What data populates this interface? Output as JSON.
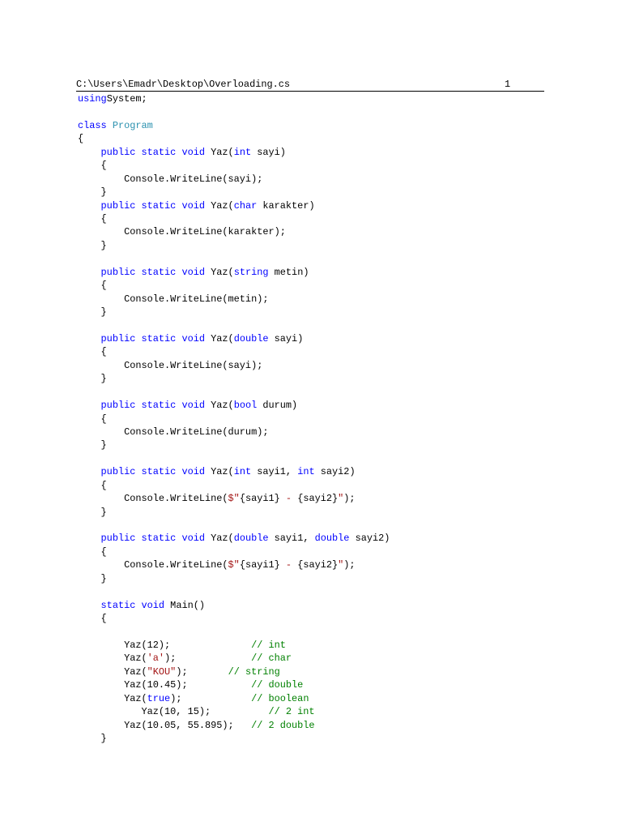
{
  "header": {
    "file_path": "C:\\Users\\Emadr\\Desktop\\Overloading.cs",
    "page_number": "1"
  },
  "colors": {
    "keyword": "#0000ff",
    "type": "#2b91af",
    "string": "#a31515",
    "comment": "#008000"
  },
  "code_lines": [
    [
      [
        "k",
        "using"
      ],
      [
        "",
        "System;"
      ]
    ],
    [],
    [
      [
        "k",
        "class"
      ],
      [
        "",
        " "
      ],
      [
        "y",
        "Program"
      ]
    ],
    [
      [
        "",
        "{"
      ]
    ],
    [
      [
        "",
        "    "
      ],
      [
        "k",
        "public static void"
      ],
      [
        "",
        " Yaz("
      ],
      [
        "k",
        "int"
      ],
      [
        "",
        " sayi)"
      ]
    ],
    [
      [
        "",
        "    {"
      ]
    ],
    [
      [
        "",
        "        Console.WriteLine(sayi);"
      ]
    ],
    [
      [
        "",
        "    }"
      ]
    ],
    [
      [
        "",
        "    "
      ],
      [
        "k",
        "public static void"
      ],
      [
        "",
        " Yaz("
      ],
      [
        "k",
        "char"
      ],
      [
        "",
        " karakter)"
      ]
    ],
    [
      [
        "",
        "    {"
      ]
    ],
    [
      [
        "",
        "        Console.WriteLine(karakter);"
      ]
    ],
    [
      [
        "",
        "    }"
      ]
    ],
    [],
    [
      [
        "",
        "    "
      ],
      [
        "k",
        "public static void"
      ],
      [
        "",
        " Yaz("
      ],
      [
        "k",
        "string"
      ],
      [
        "",
        " metin)"
      ]
    ],
    [
      [
        "",
        "    {"
      ]
    ],
    [
      [
        "",
        "        Console.WriteLine(metin);"
      ]
    ],
    [
      [
        "",
        "    }"
      ]
    ],
    [],
    [
      [
        "",
        "    "
      ],
      [
        "k",
        "public static void"
      ],
      [
        "",
        " Yaz("
      ],
      [
        "k",
        "double"
      ],
      [
        "",
        " sayi)"
      ]
    ],
    [
      [
        "",
        "    {"
      ]
    ],
    [
      [
        "",
        "        Console.WriteLine(sayi);"
      ]
    ],
    [
      [
        "",
        "    }"
      ]
    ],
    [],
    [
      [
        "",
        "    "
      ],
      [
        "k",
        "public static void"
      ],
      [
        "",
        " Yaz("
      ],
      [
        "k",
        "bool"
      ],
      [
        "",
        " durum)"
      ]
    ],
    [
      [
        "",
        "    {"
      ]
    ],
    [
      [
        "",
        "        Console.WriteLine(durum);"
      ]
    ],
    [
      [
        "",
        "    }"
      ]
    ],
    [],
    [
      [
        "",
        "    "
      ],
      [
        "k",
        "public static void"
      ],
      [
        "",
        " Yaz("
      ],
      [
        "k",
        "int"
      ],
      [
        "",
        " sayi1, "
      ],
      [
        "k",
        "int"
      ],
      [
        "",
        " sayi2)"
      ]
    ],
    [
      [
        "",
        "    {"
      ]
    ],
    [
      [
        "",
        "        Console.WriteLine("
      ],
      [
        "s",
        "$\""
      ],
      [
        "",
        "{sayi1}"
      ],
      [
        "s",
        " - "
      ],
      [
        "",
        "{sayi2}"
      ],
      [
        "s",
        "\""
      ],
      [
        "",
        ");"
      ]
    ],
    [
      [
        "",
        "    }"
      ]
    ],
    [],
    [
      [
        "",
        "    "
      ],
      [
        "k",
        "public static void"
      ],
      [
        "",
        " Yaz("
      ],
      [
        "k",
        "double"
      ],
      [
        "",
        " sayi1, "
      ],
      [
        "k",
        "double"
      ],
      [
        "",
        " sayi2)"
      ]
    ],
    [
      [
        "",
        "    {"
      ]
    ],
    [
      [
        "",
        "        Console.WriteLine("
      ],
      [
        "s",
        "$\""
      ],
      [
        "",
        "{sayi1}"
      ],
      [
        "s",
        " - "
      ],
      [
        "",
        "{sayi2}"
      ],
      [
        "s",
        "\""
      ],
      [
        "",
        ");"
      ]
    ],
    [
      [
        "",
        "    }"
      ]
    ],
    [],
    [
      [
        "",
        "    "
      ],
      [
        "k",
        "static void"
      ],
      [
        "",
        " Main()"
      ]
    ],
    [
      [
        "",
        "    {"
      ]
    ],
    [],
    [
      [
        "",
        "        Yaz(12);              "
      ],
      [
        "c",
        "// int"
      ]
    ],
    [
      [
        "",
        "        Yaz("
      ],
      [
        "s",
        "'a'"
      ],
      [
        "",
        ");             "
      ],
      [
        "c",
        "// char"
      ]
    ],
    [
      [
        "",
        "        Yaz("
      ],
      [
        "s",
        "\"KOU\""
      ],
      [
        "",
        ");       "
      ],
      [
        "c",
        "// string"
      ]
    ],
    [
      [
        "",
        "        Yaz(10.45);           "
      ],
      [
        "c",
        "// double"
      ]
    ],
    [
      [
        "",
        "        Yaz("
      ],
      [
        "k",
        "true"
      ],
      [
        "",
        ");            "
      ],
      [
        "c",
        "// boolean"
      ]
    ],
    [
      [
        "",
        "           Yaz(10, 15);          "
      ],
      [
        "c",
        "// 2 int"
      ]
    ],
    [
      [
        "",
        "        Yaz(10.05, 55.895);   "
      ],
      [
        "c",
        "// 2 double"
      ]
    ],
    [
      [
        "",
        "    }"
      ]
    ]
  ]
}
